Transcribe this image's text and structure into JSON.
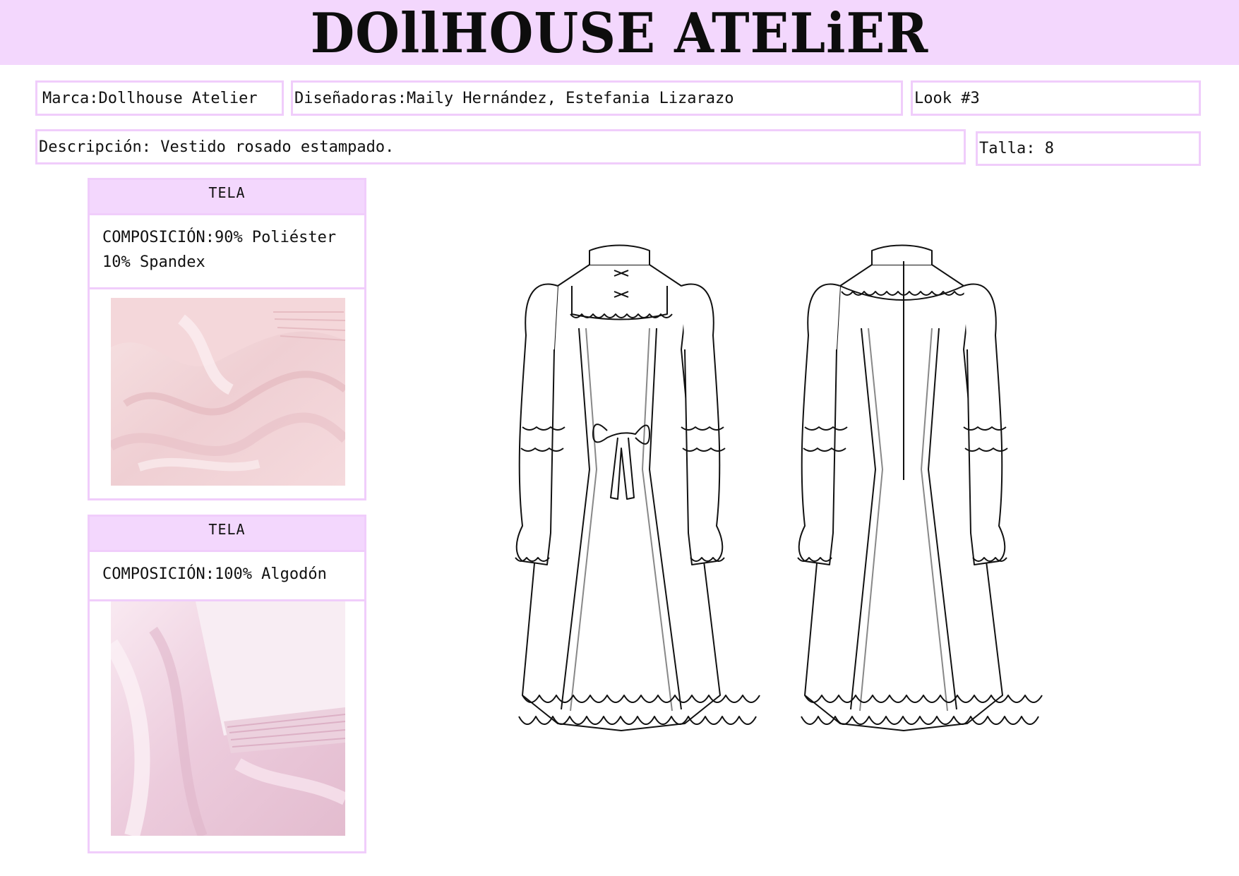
{
  "header": {
    "brand_title": "DOllHOUSE ATELiER"
  },
  "info": {
    "marca_label": "Marca:",
    "marca_value": "Dollhouse Atelier",
    "disenadoras_label": "Diseñadoras:",
    "disenadoras_value": "Maily Hernández, Estefania Lizarazo",
    "look": "Look #3",
    "descripcion_label": "Descripción:",
    "descripcion_value": "Vestido rosado estampado.",
    "talla_label": "Talla:",
    "talla_value": "8"
  },
  "fabrics": [
    {
      "header": "TELA",
      "composition_label": "COMPOSICIÓN:",
      "composition_line1": "90% Poliéster",
      "composition_line2": "10% Spandex"
    },
    {
      "header": "TELA",
      "composition_label": "COMPOSICIÓN:",
      "composition_line1": "100% Algodón"
    }
  ],
  "colors": {
    "banner": "#f3d7fd",
    "border": "#f0cdfb",
    "fabric_pink_light": "#f6dfe1",
    "fabric_pink_mid": "#e9c3c8",
    "fabric2_pink_light": "#f8e6ef",
    "fabric2_pink_mid": "#e7c2d6"
  },
  "images": {
    "fabric1": "pink-satin-fabric-swatch",
    "fabric2": "pink-cotton-fabric-roll-swatch",
    "flat_front": "dress-flat-sketch-front",
    "flat_back": "dress-flat-sketch-back"
  }
}
